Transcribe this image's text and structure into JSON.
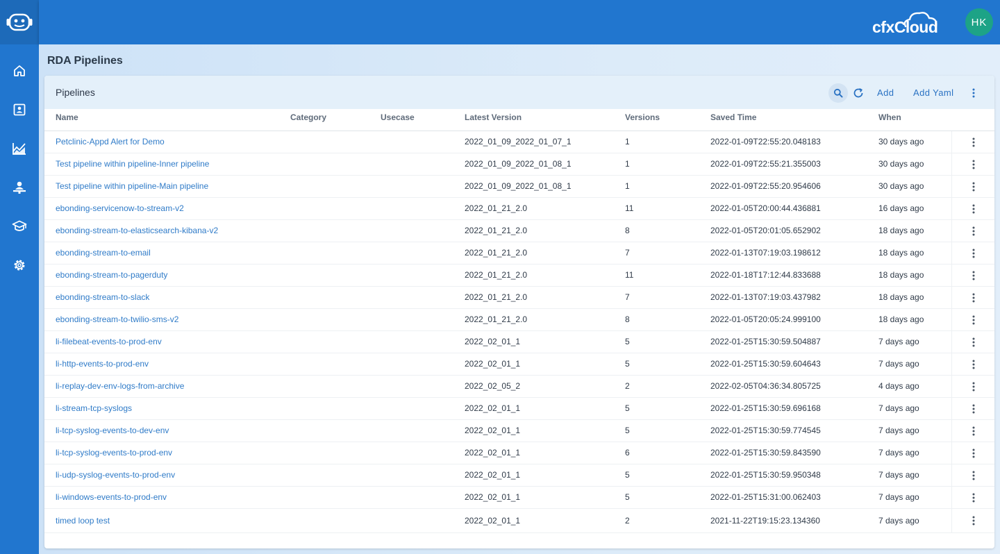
{
  "header": {
    "brand": "cfxCloud",
    "user_initials": "HK"
  },
  "sidebar": {
    "items": [
      {
        "icon": "home-icon"
      },
      {
        "icon": "contact-card-icon"
      },
      {
        "icon": "analytics-chart-icon"
      },
      {
        "icon": "user-desk-icon"
      },
      {
        "icon": "graduation-cap-icon"
      },
      {
        "icon": "gear-icon"
      }
    ]
  },
  "page": {
    "title": "RDA Pipelines"
  },
  "card": {
    "title": "Pipelines",
    "add_label": "Add",
    "add_yaml_label": "Add Yaml"
  },
  "table": {
    "columns": {
      "name": "Name",
      "category": "Category",
      "usecase": "Usecase",
      "latest_version": "Latest Version",
      "versions": "Versions",
      "saved_time": "Saved Time",
      "when": "When"
    },
    "rows": [
      {
        "name": "Petclinic-Appd Alert for Demo",
        "category": "",
        "usecase": "",
        "latest_version": "2022_01_09_2022_01_07_1",
        "versions": "1",
        "saved_time": "2022-01-09T22:55:20.048183",
        "when": "30 days ago"
      },
      {
        "name": "Test pipeline within pipeline-Inner pipeline",
        "category": "",
        "usecase": "",
        "latest_version": "2022_01_09_2022_01_08_1",
        "versions": "1",
        "saved_time": "2022-01-09T22:55:21.355003",
        "when": "30 days ago"
      },
      {
        "name": "Test pipeline within pipeline-Main pipeline",
        "category": "",
        "usecase": "",
        "latest_version": "2022_01_09_2022_01_08_1",
        "versions": "1",
        "saved_time": "2022-01-09T22:55:20.954606",
        "when": "30 days ago"
      },
      {
        "name": "ebonding-servicenow-to-stream-v2",
        "category": "",
        "usecase": "",
        "latest_version": "2022_01_21_2.0",
        "versions": "11",
        "saved_time": "2022-01-05T20:00:44.436881",
        "when": "16 days ago"
      },
      {
        "name": "ebonding-stream-to-elasticsearch-kibana-v2",
        "category": "",
        "usecase": "",
        "latest_version": "2022_01_21_2.0",
        "versions": "8",
        "saved_time": "2022-01-05T20:01:05.652902",
        "when": "18 days ago"
      },
      {
        "name": "ebonding-stream-to-email",
        "category": "",
        "usecase": "",
        "latest_version": "2022_01_21_2.0",
        "versions": "7",
        "saved_time": "2022-01-13T07:19:03.198612",
        "when": "18 days ago"
      },
      {
        "name": "ebonding-stream-to-pagerduty",
        "category": "",
        "usecase": "",
        "latest_version": "2022_01_21_2.0",
        "versions": "11",
        "saved_time": "2022-01-18T17:12:44.833688",
        "when": "18 days ago"
      },
      {
        "name": "ebonding-stream-to-slack",
        "category": "",
        "usecase": "",
        "latest_version": "2022_01_21_2.0",
        "versions": "7",
        "saved_time": "2022-01-13T07:19:03.437982",
        "when": "18 days ago"
      },
      {
        "name": "ebonding-stream-to-twilio-sms-v2",
        "category": "",
        "usecase": "",
        "latest_version": "2022_01_21_2.0",
        "versions": "8",
        "saved_time": "2022-01-05T20:05:24.999100",
        "when": "18 days ago"
      },
      {
        "name": "li-filebeat-events-to-prod-env",
        "category": "",
        "usecase": "",
        "latest_version": "2022_02_01_1",
        "versions": "5",
        "saved_time": "2022-01-25T15:30:59.504887",
        "when": "7 days ago"
      },
      {
        "name": "li-http-events-to-prod-env",
        "category": "",
        "usecase": "",
        "latest_version": "2022_02_01_1",
        "versions": "5",
        "saved_time": "2022-01-25T15:30:59.604643",
        "when": "7 days ago"
      },
      {
        "name": "li-replay-dev-env-logs-from-archive",
        "category": "",
        "usecase": "",
        "latest_version": "2022_02_05_2",
        "versions": "2",
        "saved_time": "2022-02-05T04:36:34.805725",
        "when": "4 days ago"
      },
      {
        "name": "li-stream-tcp-syslogs",
        "category": "",
        "usecase": "",
        "latest_version": "2022_02_01_1",
        "versions": "5",
        "saved_time": "2022-01-25T15:30:59.696168",
        "when": "7 days ago"
      },
      {
        "name": "li-tcp-syslog-events-to-dev-env",
        "category": "",
        "usecase": "",
        "latest_version": "2022_02_01_1",
        "versions": "5",
        "saved_time": "2022-01-25T15:30:59.774545",
        "when": "7 days ago"
      },
      {
        "name": "li-tcp-syslog-events-to-prod-env",
        "category": "",
        "usecase": "",
        "latest_version": "2022_02_01_1",
        "versions": "6",
        "saved_time": "2022-01-25T15:30:59.843590",
        "when": "7 days ago"
      },
      {
        "name": "li-udp-syslog-events-to-prod-env",
        "category": "",
        "usecase": "",
        "latest_version": "2022_02_01_1",
        "versions": "5",
        "saved_time": "2022-01-25T15:30:59.950348",
        "when": "7 days ago"
      },
      {
        "name": "li-windows-events-to-prod-env",
        "category": "",
        "usecase": "",
        "latest_version": "2022_02_01_1",
        "versions": "5",
        "saved_time": "2022-01-25T15:31:00.062403",
        "when": "7 days ago"
      },
      {
        "name": "timed loop test",
        "category": "",
        "usecase": "",
        "latest_version": "2022_02_01_1",
        "versions": "2",
        "saved_time": "2021-11-22T19:15:23.134360",
        "when": "7 days ago"
      }
    ]
  },
  "colors": {
    "primary": "#2176cf",
    "link": "#2f7bc8",
    "avatar": "#1da386",
    "card_header": "#e4f0fa"
  }
}
